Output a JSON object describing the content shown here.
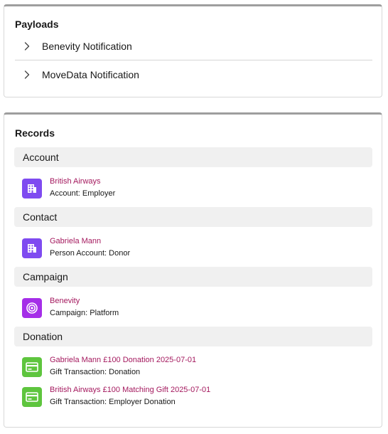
{
  "payloads": {
    "title": "Payloads",
    "items": [
      {
        "label": "Benevity Notification"
      },
      {
        "label": "MoveData Notification"
      }
    ]
  },
  "records": {
    "title": "Records",
    "sections": [
      {
        "header": "Account",
        "items": [
          {
            "icon": "building-icon",
            "icon_color": "#7f4bf0",
            "link": "British Airways",
            "sub": "Account: Employer"
          }
        ]
      },
      {
        "header": "Contact",
        "items": [
          {
            "icon": "building-icon",
            "icon_color": "#7f4bf0",
            "link": "Gabriela Mann",
            "sub": "Person Account: Donor"
          }
        ]
      },
      {
        "header": "Campaign",
        "items": [
          {
            "icon": "target-icon",
            "icon_color": "#a52ee8",
            "link": "Benevity",
            "sub": "Campaign: Platform"
          }
        ]
      },
      {
        "header": "Donation",
        "items": [
          {
            "icon": "card-icon",
            "icon_color": "#5ec53e",
            "link": "Gabriela Mann £100 Donation 2025-07-01",
            "sub": "Gift Transaction: Donation"
          },
          {
            "icon": "card-icon",
            "icon_color": "#5ec53e",
            "link": "British Airways £100 Matching Gift 2025-07-01",
            "sub": "Gift Transaction: Employer Donation"
          }
        ]
      }
    ]
  },
  "colors": {
    "link": "#a4195e",
    "section_bg": "#f0f0f0",
    "card_top_border": "#9e9e9e"
  }
}
